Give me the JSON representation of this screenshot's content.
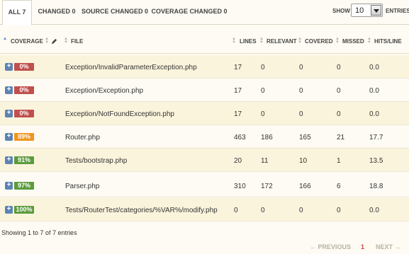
{
  "tabs": [
    {
      "label": "ALL 7"
    },
    {
      "label": "CHANGED 0"
    },
    {
      "label": "SOURCE CHANGED 0"
    },
    {
      "label": "COVERAGE CHANGED 0"
    }
  ],
  "length_control": {
    "show_label": "SHOW",
    "value": "10",
    "entries_label": "ENTRIES"
  },
  "columns": {
    "coverage": "COVERAGE",
    "file": "FILE",
    "lines": "LINES",
    "relevant": "RELEVANT",
    "covered": "COVERED",
    "missed": "MISSED",
    "hits": "HITS/LINE"
  },
  "icons": {
    "expand": "plus-icon",
    "edit": "pencil-icon",
    "sort": "sort-arrows-icon"
  },
  "colors": {
    "red": "#c0504d",
    "orange": "#f0961e",
    "green": "#5b9b3c",
    "link": "#4b85c5"
  },
  "rows": [
    {
      "coverage": "0%",
      "level": "red",
      "file": "Exception/InvalidParameterException.php",
      "lines": "17",
      "relevant": "0",
      "covered": "0",
      "missed": "0",
      "hits": "0.0"
    },
    {
      "coverage": "0%",
      "level": "red",
      "file": "Exception/Exception.php",
      "lines": "17",
      "relevant": "0",
      "covered": "0",
      "missed": "0",
      "hits": "0.0"
    },
    {
      "coverage": "0%",
      "level": "red",
      "file": "Exception/NotFoundException.php",
      "lines": "17",
      "relevant": "0",
      "covered": "0",
      "missed": "0",
      "hits": "0.0"
    },
    {
      "coverage": "89%",
      "level": "orange",
      "file": "Router.php",
      "lines": "463",
      "relevant": "186",
      "covered": "165",
      "missed": "21",
      "hits": "17.7"
    },
    {
      "coverage": "91%",
      "level": "green",
      "file": "Tests/bootstrap.php",
      "lines": "20",
      "relevant": "11",
      "covered": "10",
      "missed": "1",
      "hits": "13.5"
    },
    {
      "coverage": "97%",
      "level": "green",
      "file": "Parser.php",
      "lines": "310",
      "relevant": "172",
      "covered": "166",
      "missed": "6",
      "hits": "18.8"
    },
    {
      "coverage": "100%",
      "level": "green",
      "file": "Tests/RouterTest/categories/%VAR%/modify.php",
      "lines": "0",
      "relevant": "0",
      "covered": "0",
      "missed": "0",
      "hits": "0.0"
    }
  ],
  "footer": {
    "info": "Showing 1 to 7 of 7 entries",
    "previous": "← PREVIOUS",
    "page": "1",
    "next": "NEXT →"
  }
}
